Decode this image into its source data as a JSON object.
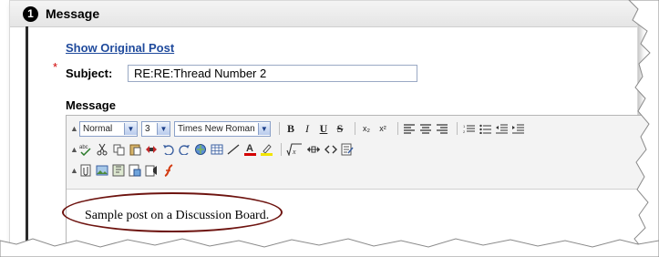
{
  "step": {
    "number": "1",
    "title": "Message"
  },
  "form": {
    "show_original_link": "Show Original Post",
    "required_marker": "*",
    "subject_label": "Subject:",
    "subject_value": "RE:RE:Thread Number 2",
    "message_label": "Message"
  },
  "toolbar": {
    "style_select": "Normal",
    "size_select": "3",
    "font_select": "Times New Roman",
    "bold": "B",
    "italic": "I",
    "underline": "U",
    "strikethrough": "S",
    "subscript": "x₂",
    "superscript": "x²"
  },
  "editor": {
    "content": "Sample post on a Discussion Board."
  },
  "colors": {
    "link": "#1f4a9c",
    "required": "#d00000",
    "oval": "#6e1410",
    "header_bg": "#e5e5e5"
  }
}
